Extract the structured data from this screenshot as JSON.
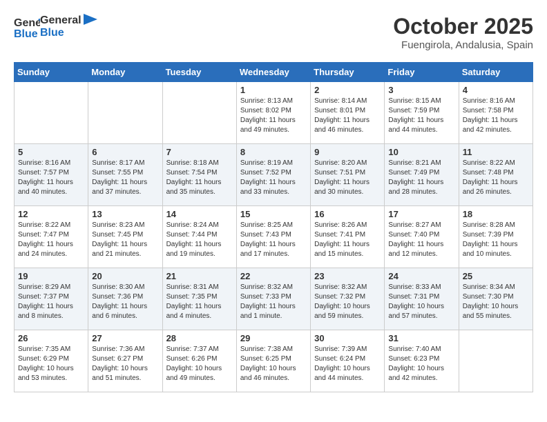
{
  "logo": {
    "general": "General",
    "blue": "Blue"
  },
  "title": "October 2025",
  "location": "Fuengirola, Andalusia, Spain",
  "days_of_week": [
    "Sunday",
    "Monday",
    "Tuesday",
    "Wednesday",
    "Thursday",
    "Friday",
    "Saturday"
  ],
  "weeks": [
    [
      {
        "day": "",
        "info": ""
      },
      {
        "day": "",
        "info": ""
      },
      {
        "day": "",
        "info": ""
      },
      {
        "day": "1",
        "info": "Sunrise: 8:13 AM\nSunset: 8:02 PM\nDaylight: 11 hours and 49 minutes."
      },
      {
        "day": "2",
        "info": "Sunrise: 8:14 AM\nSunset: 8:01 PM\nDaylight: 11 hours and 46 minutes."
      },
      {
        "day": "3",
        "info": "Sunrise: 8:15 AM\nSunset: 7:59 PM\nDaylight: 11 hours and 44 minutes."
      },
      {
        "day": "4",
        "info": "Sunrise: 8:16 AM\nSunset: 7:58 PM\nDaylight: 11 hours and 42 minutes."
      }
    ],
    [
      {
        "day": "5",
        "info": "Sunrise: 8:16 AM\nSunset: 7:57 PM\nDaylight: 11 hours and 40 minutes."
      },
      {
        "day": "6",
        "info": "Sunrise: 8:17 AM\nSunset: 7:55 PM\nDaylight: 11 hours and 37 minutes."
      },
      {
        "day": "7",
        "info": "Sunrise: 8:18 AM\nSunset: 7:54 PM\nDaylight: 11 hours and 35 minutes."
      },
      {
        "day": "8",
        "info": "Sunrise: 8:19 AM\nSunset: 7:52 PM\nDaylight: 11 hours and 33 minutes."
      },
      {
        "day": "9",
        "info": "Sunrise: 8:20 AM\nSunset: 7:51 PM\nDaylight: 11 hours and 30 minutes."
      },
      {
        "day": "10",
        "info": "Sunrise: 8:21 AM\nSunset: 7:49 PM\nDaylight: 11 hours and 28 minutes."
      },
      {
        "day": "11",
        "info": "Sunrise: 8:22 AM\nSunset: 7:48 PM\nDaylight: 11 hours and 26 minutes."
      }
    ],
    [
      {
        "day": "12",
        "info": "Sunrise: 8:22 AM\nSunset: 7:47 PM\nDaylight: 11 hours and 24 minutes."
      },
      {
        "day": "13",
        "info": "Sunrise: 8:23 AM\nSunset: 7:45 PM\nDaylight: 11 hours and 21 minutes."
      },
      {
        "day": "14",
        "info": "Sunrise: 8:24 AM\nSunset: 7:44 PM\nDaylight: 11 hours and 19 minutes."
      },
      {
        "day": "15",
        "info": "Sunrise: 8:25 AM\nSunset: 7:43 PM\nDaylight: 11 hours and 17 minutes."
      },
      {
        "day": "16",
        "info": "Sunrise: 8:26 AM\nSunset: 7:41 PM\nDaylight: 11 hours and 15 minutes."
      },
      {
        "day": "17",
        "info": "Sunrise: 8:27 AM\nSunset: 7:40 PM\nDaylight: 11 hours and 12 minutes."
      },
      {
        "day": "18",
        "info": "Sunrise: 8:28 AM\nSunset: 7:39 PM\nDaylight: 11 hours and 10 minutes."
      }
    ],
    [
      {
        "day": "19",
        "info": "Sunrise: 8:29 AM\nSunset: 7:37 PM\nDaylight: 11 hours and 8 minutes."
      },
      {
        "day": "20",
        "info": "Sunrise: 8:30 AM\nSunset: 7:36 PM\nDaylight: 11 hours and 6 minutes."
      },
      {
        "day": "21",
        "info": "Sunrise: 8:31 AM\nSunset: 7:35 PM\nDaylight: 11 hours and 4 minutes."
      },
      {
        "day": "22",
        "info": "Sunrise: 8:32 AM\nSunset: 7:33 PM\nDaylight: 11 hours and 1 minute."
      },
      {
        "day": "23",
        "info": "Sunrise: 8:32 AM\nSunset: 7:32 PM\nDaylight: 10 hours and 59 minutes."
      },
      {
        "day": "24",
        "info": "Sunrise: 8:33 AM\nSunset: 7:31 PM\nDaylight: 10 hours and 57 minutes."
      },
      {
        "day": "25",
        "info": "Sunrise: 8:34 AM\nSunset: 7:30 PM\nDaylight: 10 hours and 55 minutes."
      }
    ],
    [
      {
        "day": "26",
        "info": "Sunrise: 7:35 AM\nSunset: 6:29 PM\nDaylight: 10 hours and 53 minutes."
      },
      {
        "day": "27",
        "info": "Sunrise: 7:36 AM\nSunset: 6:27 PM\nDaylight: 10 hours and 51 minutes."
      },
      {
        "day": "28",
        "info": "Sunrise: 7:37 AM\nSunset: 6:26 PM\nDaylight: 10 hours and 49 minutes."
      },
      {
        "day": "29",
        "info": "Sunrise: 7:38 AM\nSunset: 6:25 PM\nDaylight: 10 hours and 46 minutes."
      },
      {
        "day": "30",
        "info": "Sunrise: 7:39 AM\nSunset: 6:24 PM\nDaylight: 10 hours and 44 minutes."
      },
      {
        "day": "31",
        "info": "Sunrise: 7:40 AM\nSunset: 6:23 PM\nDaylight: 10 hours and 42 minutes."
      },
      {
        "day": "",
        "info": ""
      }
    ]
  ]
}
